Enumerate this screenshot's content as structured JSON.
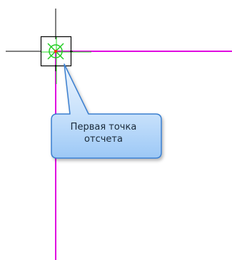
{
  "tooltip": {
    "line1": "Первая точка",
    "line2": "отсчета"
  },
  "colors": {
    "background": "#ffffff",
    "x_axis": "#e000e0",
    "y_axis": "#e000e0",
    "snap_guide": "#22dd22",
    "cursor": "#000000",
    "snap_marker": "#22cc22",
    "snap_center": "#ff3300",
    "tooltip_fill_top": "#eaf4ff",
    "tooltip_fill_bottom": "#a9cff8",
    "tooltip_border": "#3a7fd0"
  },
  "icons": {
    "cursor": "crosshair-pickbox-icon",
    "snap": "endpoint-snap-marker-icon"
  }
}
